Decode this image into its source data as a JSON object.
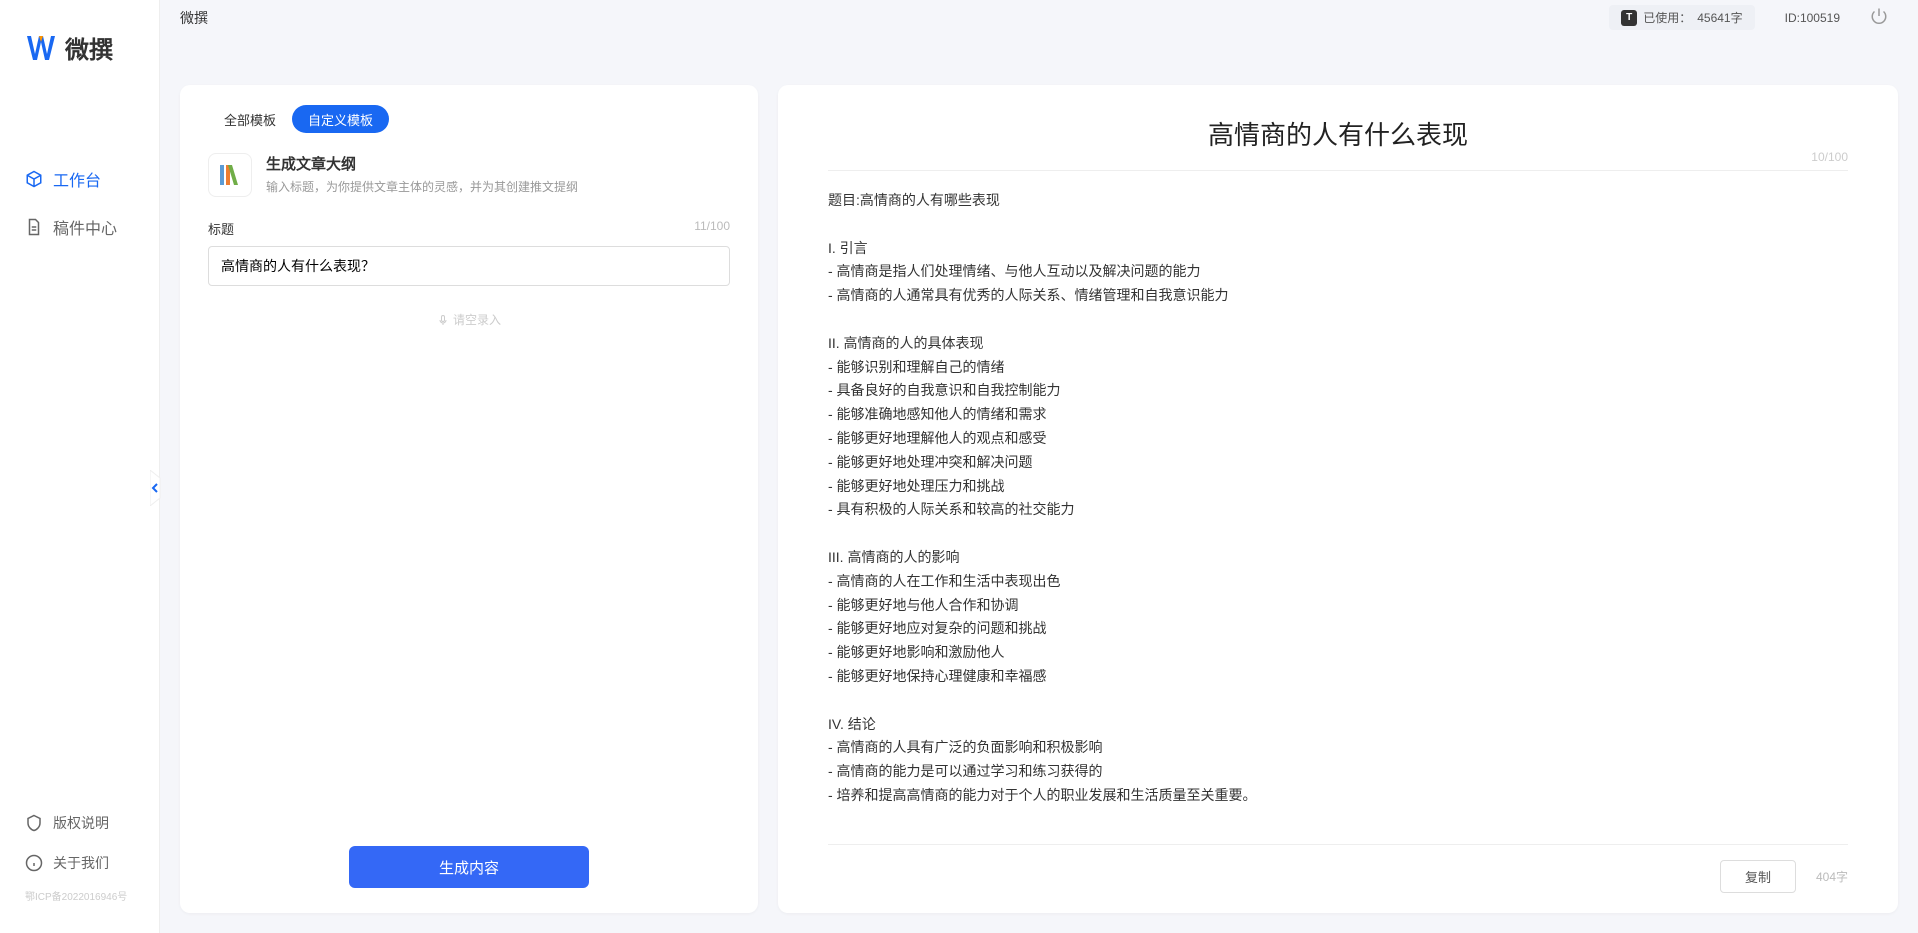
{
  "app": {
    "logo_text": "微撰",
    "icp": "鄂ICP备2022016946号"
  },
  "sidebar": {
    "nav": [
      {
        "label": "工作台"
      },
      {
        "label": "稿件中心"
      }
    ],
    "bottom": [
      {
        "label": "版权说明"
      },
      {
        "label": "关于我们"
      }
    ]
  },
  "header": {
    "title": "微撰",
    "usage_label": "已使用：",
    "usage_value": "45641字",
    "user_id": "ID:100519"
  },
  "left": {
    "tabs": [
      {
        "label": "全部模板"
      },
      {
        "label": "自定义模板"
      }
    ],
    "template_title": "生成文章大纲",
    "template_desc": "输入标题，为你提供文章主体的灵感，并为其创建推文提纲",
    "form_label": "标题",
    "form_counter": "11/100",
    "title_value": "高情商的人有什么表现？",
    "voice_hint": "请空录入",
    "generate_btn": "生成内容"
  },
  "right": {
    "output_title": "高情商的人有什么表现",
    "output_counter": "10/100",
    "output_body": "题目:高情商的人有哪些表现\n\nI. 引言\n- 高情商是指人们处理情绪、与他人互动以及解决问题的能力\n- 高情商的人通常具有优秀的人际关系、情绪管理和自我意识能力\n\nII. 高情商的人的具体表现\n- 能够识别和理解自己的情绪\n- 具备良好的自我意识和自我控制能力\n- 能够准确地感知他人的情绪和需求\n- 能够更好地理解他人的观点和感受\n- 能够更好地处理冲突和解决问题\n- 能够更好地处理压力和挑战\n- 具有积极的人际关系和较高的社交能力\n\nIII. 高情商的人的影响\n- 高情商的人在工作和生活中表现出色\n- 能够更好地与他人合作和协调\n- 能够更好地应对复杂的问题和挑战\n- 能够更好地影响和激励他人\n- 能够更好地保持心理健康和幸福感\n\nIV. 结论\n- 高情商的人具有广泛的负面影响和积极影响\n- 高情商的能力是可以通过学习和练习获得的\n- 培养和提高高情商的能力对于个人的职业发展和生活质量至关重要。",
    "copy_btn": "复制",
    "word_count": "404字"
  }
}
